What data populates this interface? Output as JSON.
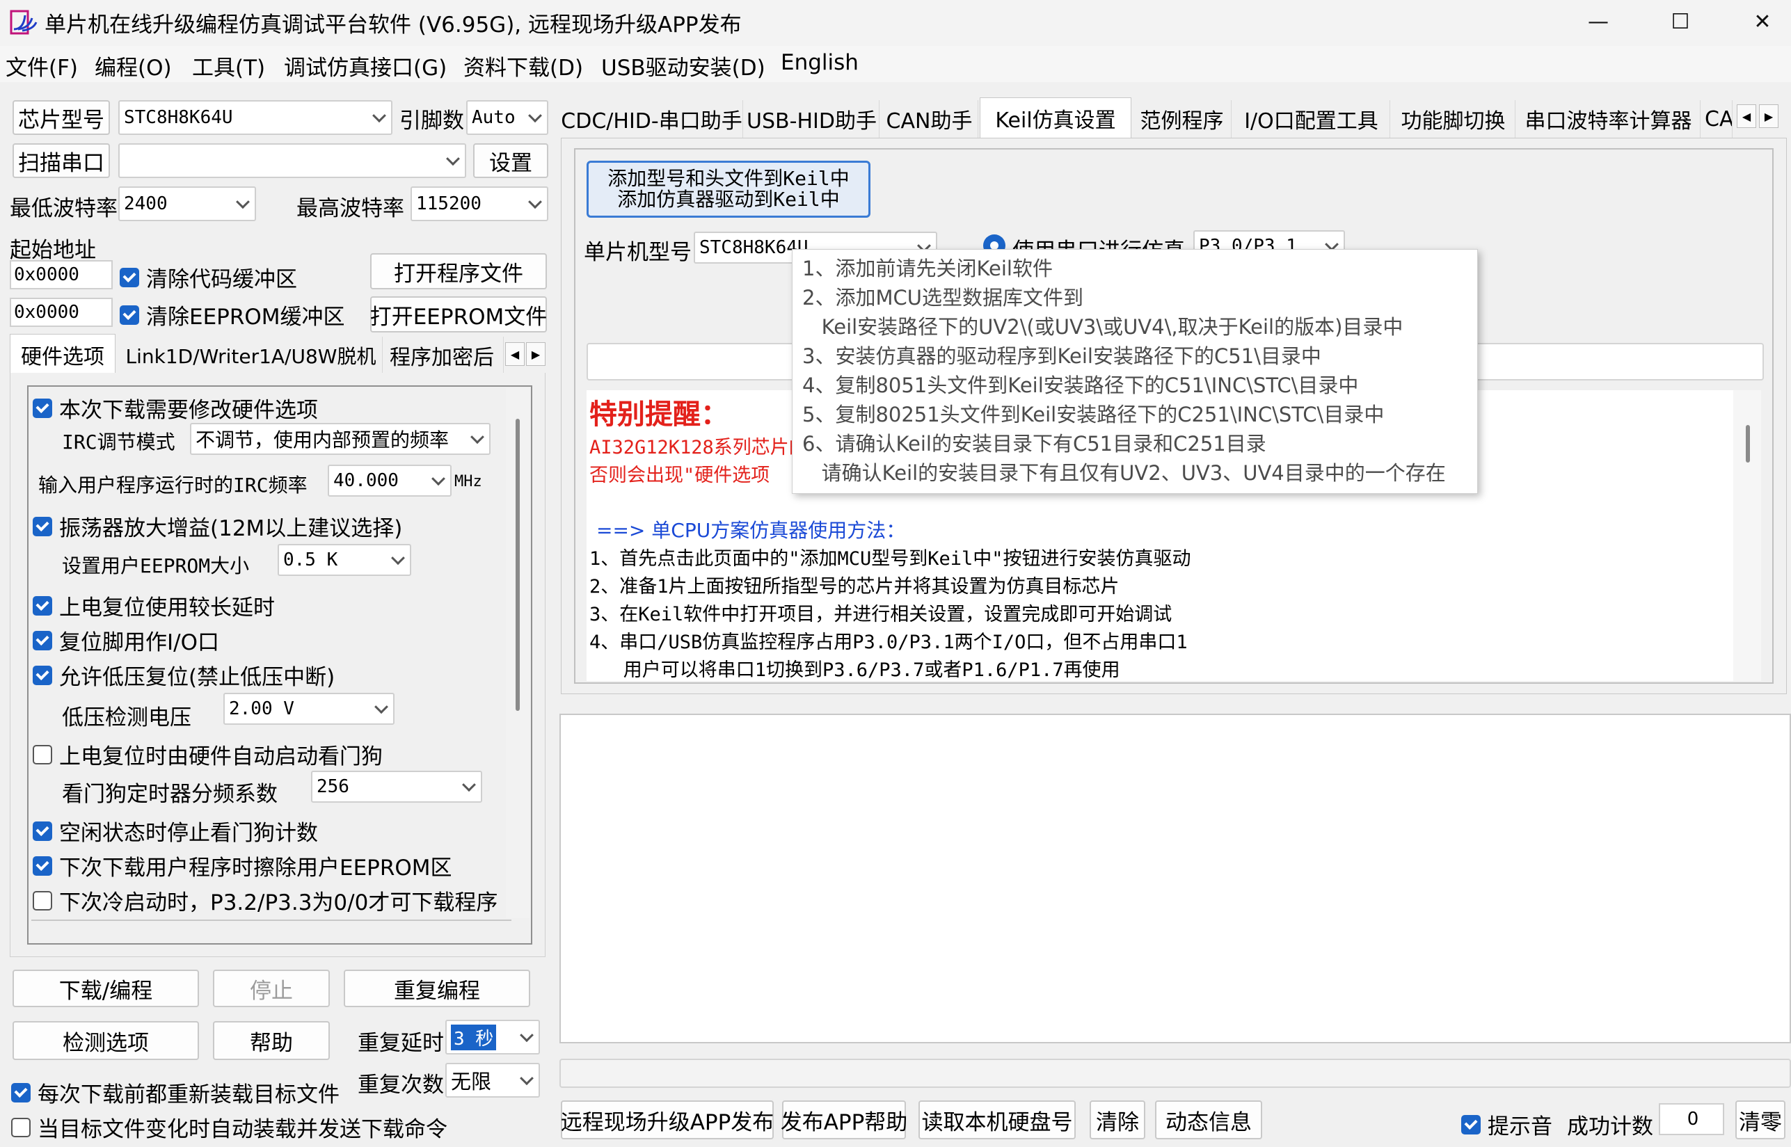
{
  "window": {
    "title": "单片机在线升级编程仿真调试平台软件 (V6.95G), 远程现场升级APP发布",
    "minimize": "—",
    "maximize": "☐",
    "close": "✕"
  },
  "menu": [
    "文件(F)",
    "编程(O)",
    "工具(T)",
    "调试仿真接口(G)",
    "资料下载(D)",
    "USB驱动安装(D)",
    "English"
  ],
  "left": {
    "chip_label": "芯片型号",
    "chip_value": "STC8H8K64U",
    "pins_label": "引脚数",
    "pins_value": "Auto",
    "scan_button": "扫描串口",
    "port_value": "",
    "settings_button": "设置",
    "min_baud_label": "最低波特率",
    "min_baud_value": "2400",
    "max_baud_label": "最高波特率",
    "max_baud_value": "115200",
    "start_addr_label": "起始地址",
    "code_addr": "0x0000",
    "clear_code_label": "清除代码缓冲区",
    "open_prog_button": "打开程序文件",
    "eeprom_addr": "0x0000",
    "clear_eeprom_label": "清除EEPROM缓冲区",
    "open_eeprom_button": "打开EEPROM文件",
    "tabs": [
      "硬件选项",
      "Link1D/Writer1A/U8W脱机",
      "程序加密后"
    ],
    "options": {
      "modify_hw": "本次下载需要修改硬件选项",
      "irc_mode_label": "IRC调节模式",
      "irc_mode_value": "不调节，使用内部预置的频率",
      "irc_freq_label": "输入用户程序运行时的IRC频率",
      "irc_freq_value": "40.000",
      "irc_freq_unit": "MHz",
      "osc_gain": "振荡器放大增益(12M以上建议选择)",
      "eeprom_size_label": "设置用户EEPROM大小",
      "eeprom_size_value": "0.5 K",
      "por_delay": "上电复位使用较长延时",
      "reset_io": "复位脚用作I/O口",
      "lvr": "允许低压复位(禁止低压中断)",
      "lvd_label": "低压检测电压",
      "lvd_value": "2.00 V",
      "wdt_auto": "上电复位时由硬件自动启动看门狗",
      "wdt_div_label": "看门狗定时器分频系数",
      "wdt_div_value": "256",
      "idle_stop_wdt": "空闲状态时停止看门狗计数",
      "erase_eeprom": "下次下载用户程序时擦除用户EEPROM区",
      "p32_cold": "下次冷启动时，P3.2/P3.3为0/0才可下载程序"
    },
    "download_button": "下载/编程",
    "stop_button": "停止",
    "repeat_button": "重复编程",
    "check_button": "检测选项",
    "help_button": "帮助",
    "repeat_delay_label": "重复延时",
    "repeat_delay_value": "3 秒",
    "repeat_count_label": "重复次数",
    "repeat_count_value": "无限",
    "reload_label": "每次下载前都重新装载目标文件",
    "auto_load_label": "当目标文件变化时自动装载并发送下载命令"
  },
  "right": {
    "tabs": [
      "CDC/HID-串口助手",
      "USB-HID助手",
      "CAN助手",
      "Keil仿真设置",
      "范例程序",
      "I/O口配置工具",
      "功能脚切换",
      "串口波特率计算器",
      "CA"
    ],
    "add_keil_line1": "添加型号和头文件到Keil中",
    "add_keil_line2": "添加仿真器驱动到Keil中",
    "mcu_model_label": "单片机型号",
    "mcu_model_value": "STC8H8K64U",
    "use_uart_label": "使用串口进行仿真",
    "uart_pins_value": "P3.0/P3.1",
    "special_title": "特别提醒：",
    "special_line1": "AI32G12K128系列芯片的",
    "special_line2": "否则会出现\"硬件选项",
    "method_title": "==> 单CPU方案仿真器使用方法：",
    "steps": [
      "1、首先点击此页面中的\"添加MCU型号到Keil中\"按钮进行安装仿真驱动",
      "2、准备1片上面按钮所指型号的芯片并将其设置为仿真目标芯片",
      "3、在Keil软件中打开项目，并进行相关设置，设置完成即可开始调试",
      "4、串口/USB仿真监控程序占用P3.0/P3.1两个I/O口，但不占用串口1",
      "   用户可以将串口1切换到P3.6/P3.7或者P1.6/P1.7再使用"
    ],
    "tooltip": [
      "1、添加前请先关闭Keil软件",
      "2、添加MCU选型数据库文件到",
      "   Keil安装路径下的UV2\\(或UV3\\或UV4\\,取决于Keil的版本)目录中",
      "3、安装仿真器的驱动程序到Keil安装路径下的C51\\目录中",
      "4、复制8051头文件到Keil安装路径下的C51\\INC\\STC\\目录中",
      "5、复制80251头文件到Keil安装路径下的C251\\INC\\STC\\目录中",
      "6、请确认Keil的安装目录下有C51目录和C251目录",
      "   请确认Keil的安装目录下有且仅有UV2、UV3、UV4目录中的一个存在"
    ]
  },
  "bottom": {
    "publish_button": "远程现场升级APP发布",
    "publish_help_button": "发布APP帮助",
    "read_disk_button": "读取本机硬盘号",
    "clear_button": "清除",
    "dynamic_button": "动态信息",
    "beep_label": "提示音",
    "success_label": "成功计数",
    "success_value": "0",
    "reset_count_button": "清零"
  }
}
